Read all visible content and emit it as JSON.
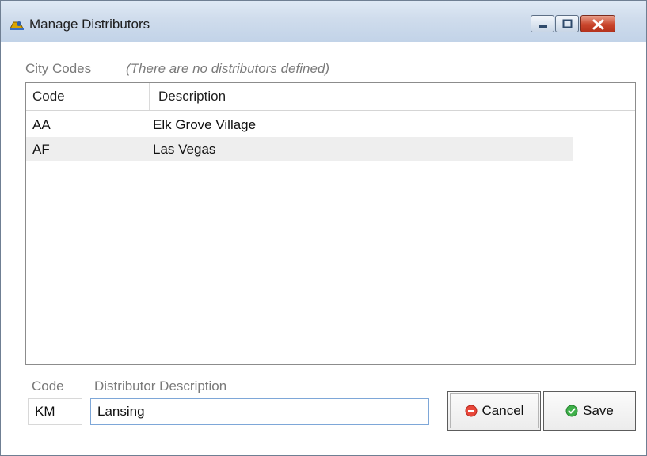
{
  "window": {
    "title": "Manage Distributors",
    "icon": "distributor-app-icon",
    "controls": [
      "minimize-icon",
      "maximize-icon",
      "close-icon"
    ]
  },
  "labels": {
    "city_codes": "City Codes",
    "no_distributors": "(There are no distributors defined)",
    "code": "Code",
    "distributor_description": "Distributor Description"
  },
  "grid": {
    "columns": [
      "Code",
      "Description"
    ],
    "rows": [
      {
        "code": "AA",
        "description": "Elk Grove Village",
        "selected": false
      },
      {
        "code": "AF",
        "description": "Las Vegas",
        "selected": true
      }
    ],
    "selected_row_color": "#eeeeee"
  },
  "form": {
    "code_value": "KM",
    "description_value": "Lansing"
  },
  "buttons": {
    "cancel_label": "Cancel",
    "cancel_icon": "cancel-icon",
    "save_label": "Save",
    "save_icon": "check-icon"
  },
  "colors": {
    "cancel_red": "#e8473a",
    "save_green": "#3fb04a",
    "label_gray": "#7a7a7a"
  }
}
